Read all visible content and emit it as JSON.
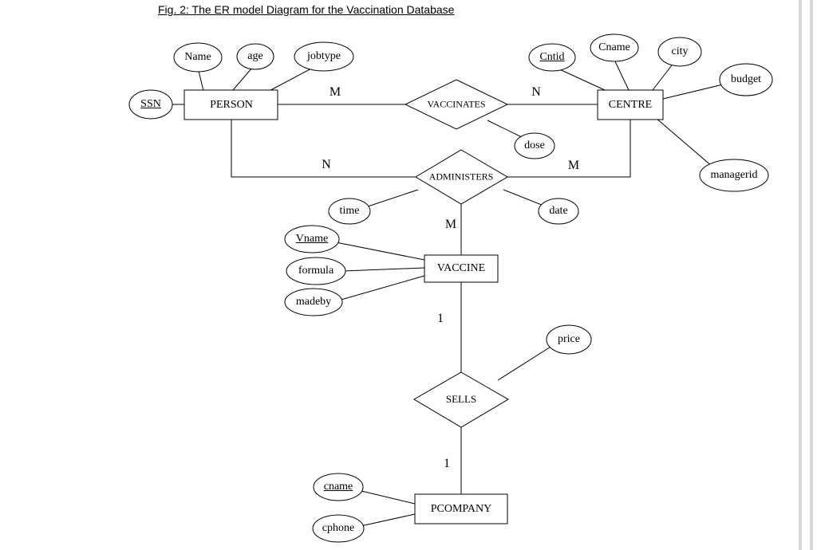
{
  "title": "Fig. 2: The ER model Diagram for the Vaccination Database",
  "entities": {
    "person": "PERSON",
    "centre": "CENTRE",
    "vaccine": "VACCINE",
    "pcompany": "PCOMPANY"
  },
  "relationships": {
    "vaccinates": "VACCINATES",
    "administers": "ADMINISTERS",
    "sells": "SELLS"
  },
  "attributes": {
    "ssn": "SSN",
    "name": "Name",
    "age": "age",
    "jobtype": "jobtype",
    "cntid": "Cntid",
    "cname_c": "Cname",
    "city": "city",
    "budget": "budget",
    "managerid": "managerid",
    "dose": "dose",
    "date": "date",
    "time": "time",
    "vname": "Vname",
    "formula": "formula",
    "madeby": "madeby",
    "price": "price",
    "cname_p": "cname",
    "cphone": "cphone"
  },
  "cardinalities": {
    "vaccinates_person": "M",
    "vaccinates_centre": "N",
    "administers_person": "N",
    "administers_centre": "M",
    "administers_vaccine": "M",
    "sells_vaccine": "1",
    "sells_pcompany": "1"
  }
}
